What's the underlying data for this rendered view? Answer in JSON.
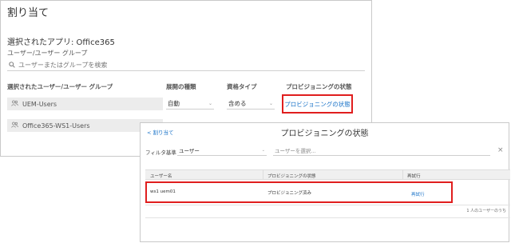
{
  "assign_panel": {
    "title": "割り当て",
    "selected_app": "選択されたアプリ: Office365",
    "group_label": "ユーザー/ユーザー グループ",
    "search_placeholder": "ユーザーまたはグループを検索",
    "columns": {
      "selected_users": "選択されたユーザー/ユーザー グループ",
      "deployment_type": "展開の種類",
      "entitlement_type": "資格タイプ",
      "provisioning_status": "プロビジョニングの状態"
    },
    "rows": [
      {
        "name": "UEM-Users",
        "deployment": "自動",
        "entitlement": "含める",
        "status_link": "プロビジョニングの状態"
      },
      {
        "name": "Office365-WS1-Users"
      }
    ]
  },
  "status_dialog": {
    "back_label": "< 割り当て",
    "title": "プロビジョニングの状態",
    "filter_label": "フィルタ基準",
    "filter_value": "ユーザー",
    "user_placeholder": "ユーザーを選択...",
    "close_glyph": "×",
    "columns": {
      "user_name": "ユーザー名",
      "status": "プロビジョニングの状態",
      "retry": "再試行"
    },
    "rows": [
      {
        "user_name": "ws1 uem01",
        "status": "プロビジョニング済み",
        "retry": "再試行"
      }
    ],
    "footer": "1 人のユーザーのうち"
  },
  "colors": {
    "highlight": "#e01e1e",
    "link": "#1a73c8"
  }
}
